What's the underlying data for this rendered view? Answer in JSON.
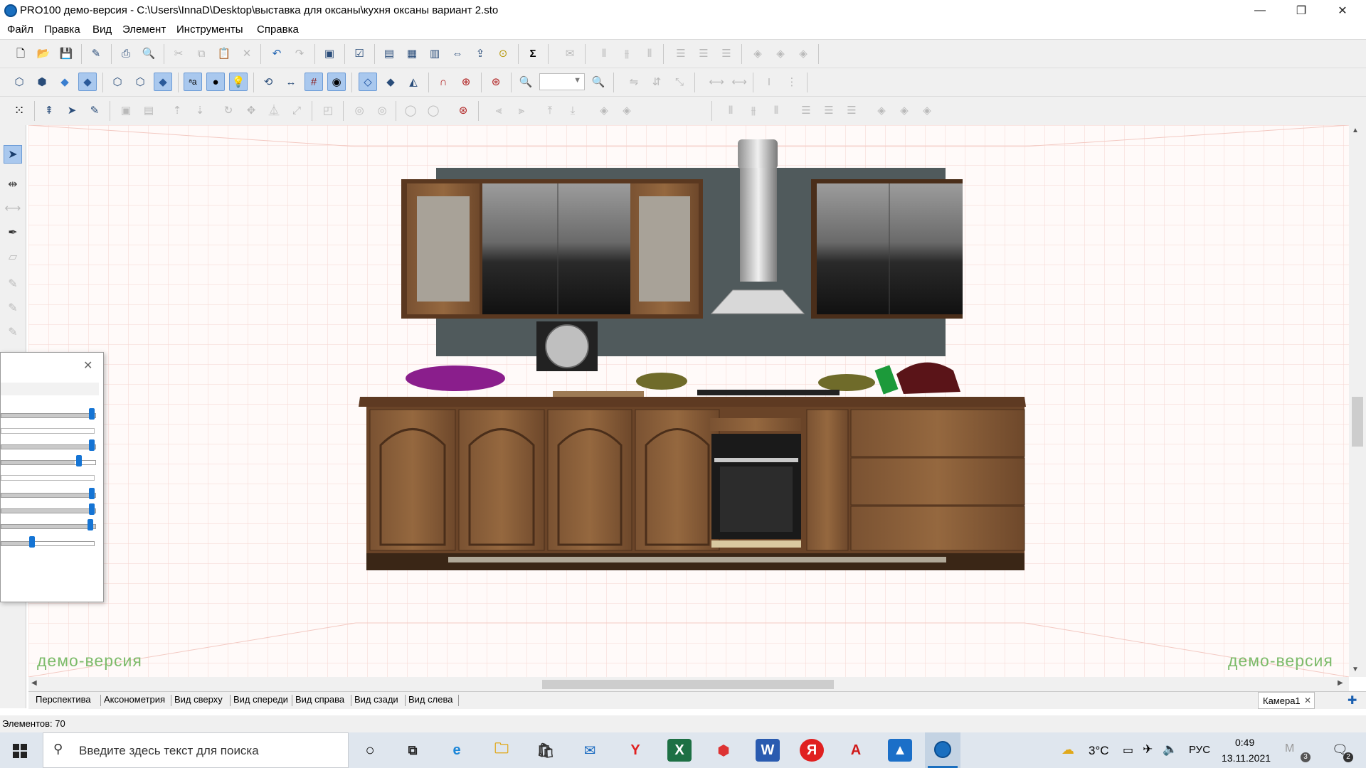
{
  "window": {
    "title": "PRO100 демо-версия - C:\\Users\\InnaD\\Desktop\\выставка для оксаны\\кухня оксаны вариант 2.sto",
    "controls": {
      "minimize": "—",
      "maximize": "❐",
      "close": "✕"
    }
  },
  "menu": [
    "Файл",
    "Правка",
    "Вид",
    "Элемент",
    "Инструменты",
    "Справка"
  ],
  "viewport": {
    "watermark_left": "демо-версия",
    "watermark_right": "демо-версия",
    "grid_color": "#f2c6c0"
  },
  "tabs": [
    "Перспектива",
    "Аксонометрия",
    "Вид сверху",
    "Вид спереди",
    "Вид справа",
    "Вид сзади",
    "Вид слева"
  ],
  "camera_tab": {
    "label": "Камера1",
    "close": "✕",
    "add": "✚"
  },
  "status": {
    "elements": "Элементов: 70"
  },
  "taskbar": {
    "search_placeholder": "Введите здесь текст для поиска",
    "weather": "3°C",
    "language": "РУС",
    "time": "0:49",
    "date": "13.11.2021",
    "notifications": "2",
    "badge": "3"
  },
  "colors": {
    "accent": "#1574d4",
    "demo_text": "#7cbb6a",
    "toolbar_bg": "#f0f0f0",
    "taskbar_bg": "#dfe6ee"
  }
}
